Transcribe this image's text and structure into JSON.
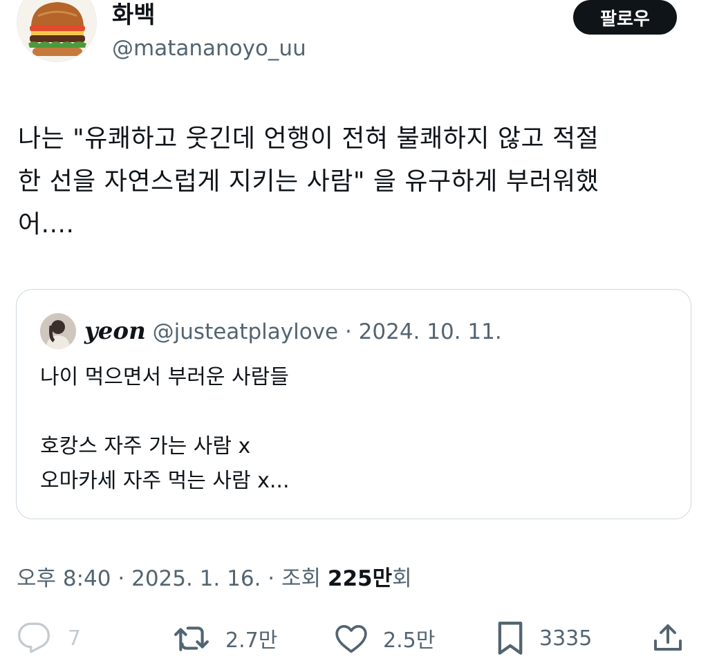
{
  "author": {
    "display_name": "화백",
    "handle": "@matananoyo_uu",
    "avatar_icon": "hamburger-avatar"
  },
  "follow_label": "팔로우",
  "tweet": {
    "lines": [
      "나는 \"유쾌하고 웃긴데 언행이 전혀 불쾌하지 않고 적절",
      "한 선을 자연스럽게 지키는 사람\" 을 유구하게 부러워했",
      "어...."
    ]
  },
  "quoted": {
    "name": "yeon",
    "handle": "@justeatplaylove",
    "separator": "·",
    "date": "2024. 10. 11.",
    "lines": [
      "나이 먹으면서 부러운 사람들",
      "",
      "호캉스 자주 가는 사람 x",
      "오마카세 자주 먹는 사람 x..."
    ]
  },
  "meta": {
    "time": "오후 8:40",
    "date": "2025. 1. 16.",
    "views_label": "조회",
    "views_count": "225만",
    "views_suffix": "회"
  },
  "actions": {
    "replies": "7",
    "retweets": "2.7만",
    "likes": "2.5만",
    "bookmarks": "3335"
  },
  "colors": {
    "text": "#0f1419",
    "secondary": "#536471",
    "border": "#cfd9de",
    "button_bg": "#0f1419"
  }
}
